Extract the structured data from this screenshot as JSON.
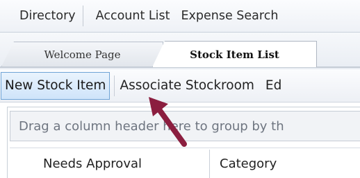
{
  "menubar": {
    "items": [
      "Directory",
      "Account List",
      "Expense Search"
    ]
  },
  "tabs": [
    {
      "label": "Welcome Page",
      "active": false
    },
    {
      "label": "Stock Item List",
      "active": true
    }
  ],
  "toolbar": {
    "new_item_label": "New Stock Item",
    "associate_label": "Associate Stockroom",
    "truncated_label": "Ed"
  },
  "grid": {
    "group_hint": "Drag a column header here to group by th",
    "columns": [
      "Needs Approval",
      "Category"
    ]
  },
  "annotation": {
    "arrow_color": "#8b1e3f"
  }
}
